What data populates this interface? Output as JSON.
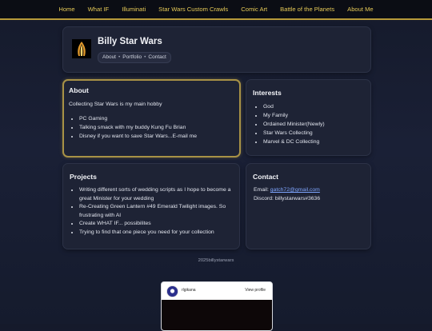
{
  "nav": {
    "items": [
      "Home",
      "What IF",
      "Illuminati",
      "Star Wars Custom Crawls",
      "Comic Art",
      "Battle of the Planets",
      "About Me"
    ]
  },
  "profile": {
    "name": "Billy Star Wars",
    "links": [
      "About",
      "Portfolio",
      "Contact"
    ],
    "separator": "•"
  },
  "about": {
    "title": "About",
    "lead": "Collecting Star Wars is my main hobby",
    "items": [
      "PC Gaming",
      "Talking smack with my buddy Kung Fu Brian",
      "Disney if you want to save Star Wars...E-mail me"
    ]
  },
  "interests": {
    "title": "Interests",
    "items": [
      "God",
      "My Family",
      "Ordained Minister(Newly)",
      "Star Wars Collecting",
      "Marvel & DC Collecting"
    ]
  },
  "projects": {
    "title": "Projects",
    "items": [
      "Writing different sorts of wedding scripts as I hope to become a great Minister for your wedding",
      "Re-Creating Green Lantern #49 Emerald Twilight images. So frustrating with AI",
      "Create WHAT IF... possibilites",
      "Trying to find that one piece you need for your collection"
    ]
  },
  "contact": {
    "title": "Contact",
    "email_label": "Email: ",
    "email": "gatch72@gmail.com",
    "discord_label": "Discord: ",
    "discord": "billystarwars#3636"
  },
  "footer": {
    "text": "2025billystarwars"
  },
  "embed": {
    "username": "rlgikana",
    "view_profile": "View profile"
  },
  "colors": {
    "accent": "#e5c957",
    "card": "#1e2335",
    "link": "#7fa6ff",
    "about_border": "#a89246"
  }
}
